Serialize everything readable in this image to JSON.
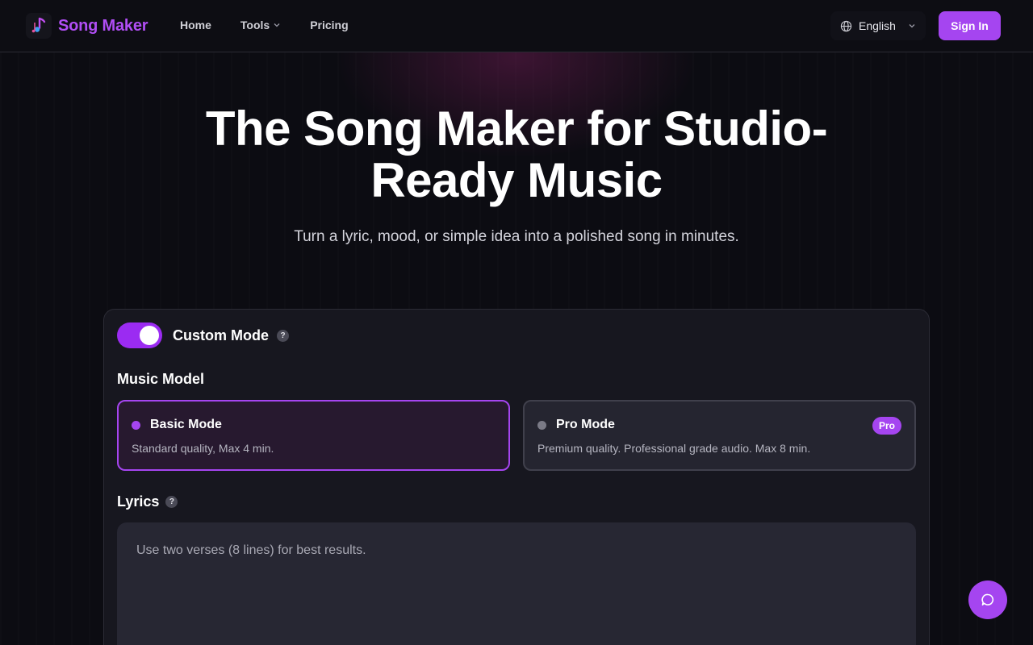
{
  "nav": {
    "brand": "Song Maker",
    "links": [
      {
        "label": "Home"
      },
      {
        "label": "Tools"
      },
      {
        "label": "Pricing"
      }
    ],
    "language": "English",
    "sign_in": "Sign In"
  },
  "hero": {
    "title_line1": "The Song Maker for Studio-",
    "title_line2": "Ready Music",
    "subtitle": "Turn a lyric, mood, or simple idea into a polished song in minutes."
  },
  "form": {
    "custom_mode": {
      "label": "Custom Mode",
      "enabled": true
    },
    "help_glyph": "?",
    "music_model_label": "Music Model",
    "models": [
      {
        "name": "Basic Mode",
        "desc": "Standard quality, Max 4 min.",
        "selected": true
      },
      {
        "name": "Pro Mode",
        "desc": "Premium quality. Professional grade audio. Max 8 min.",
        "badge": "Pro",
        "selected": false
      }
    ],
    "lyrics_label": "Lyrics",
    "lyrics_placeholder": "Use two verses (8 lines) for best results.",
    "lyrics_value": ""
  },
  "colors": {
    "accent": "#a545f0",
    "brand_text": "#b14ef5",
    "background": "#0c0c12"
  },
  "icons": {
    "logo": "music-note-icon",
    "language": "globe-icon",
    "dropdown": "chevron-down-icon",
    "help": "question-icon",
    "chat": "chat-bubble-icon"
  }
}
